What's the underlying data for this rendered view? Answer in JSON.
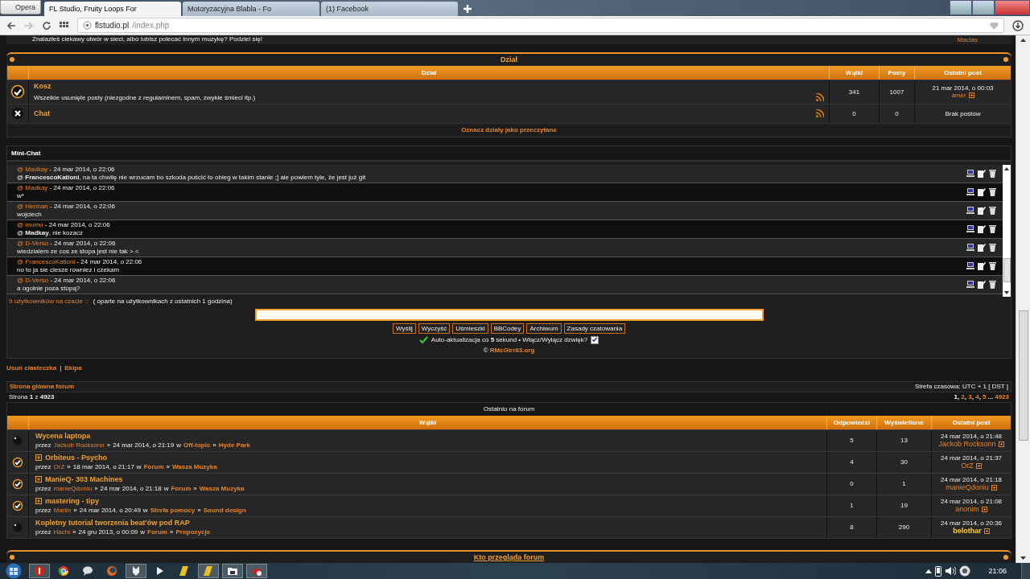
{
  "browser": {
    "menu_button": "Opera",
    "tabs": [
      {
        "title": "FL Studio, Fruity Loops For",
        "selected": true
      },
      {
        "title": "Motoryzacyjna Blabla - Fo",
        "selected": false
      },
      {
        "title": "(1) Facebook",
        "selected": false
      }
    ],
    "url": {
      "host": "flstudio.pl",
      "path": "/index.php"
    }
  },
  "intro_row": {
    "description": "Znalazłeś ciekawy utwór w sieci, albo lubisz polecać innym muzykę? Podziel się!",
    "last_author": "Macias"
  },
  "forum_section": {
    "title": "Dział",
    "columns": [
      "Dział",
      "Wątki",
      "Posty",
      "Ostatni post"
    ],
    "forums": [
      {
        "kind": "check",
        "name": "Kosz",
        "description": "Wszelkie usunięte posty (niezgodne z regulaminem, spam, zwykłe śmieci itp.)",
        "threads": "341",
        "posts": "1007",
        "last_post_date": "21 mar 2014, o 00:03",
        "last_post_author": "amer"
      },
      {
        "kind": "locked",
        "name": "Chat",
        "threads": "0",
        "posts": "0",
        "last_post_date": "Brak postów"
      }
    ],
    "mark_read": "Oznacz działy jako przeczytane"
  },
  "mini_chat": {
    "title": "Mini-Chat",
    "messages": [
      {
        "author": "@ Madkay",
        "date": "- 24 mar 2014, o 22:06",
        "text": "@ **FrancescoKationi**, na ta chwilę nie wrzucam bo szkoda puścić to obieg w takim stanie ;] ale powiem tyle, że jest już git"
      },
      {
        "author": "@ Madkay",
        "date": "- 24 mar 2014, o 22:06",
        "text": "w*"
      },
      {
        "author": "@ Herman",
        "date": "- 24 mar 2014, o 22:06",
        "text": "wojciech"
      },
      {
        "author": "@ mumu",
        "date": "- 24 mar 2014, o 22:06",
        "text": "@ **Madkay**, nie kozacz"
      },
      {
        "author": "@ D-Verso",
        "date": "- 24 mar 2014, o 22:06",
        "text": "wiedzialem ze cos ze stopa jest nie tak >.<"
      },
      {
        "author": "@ FrancescoKationi",
        "date": "- 24 mar 2014, o 22:06",
        "text": "no to ja sie ciesze rowniez i czekam"
      },
      {
        "author": "@ D-Verso",
        "date": "- 24 mar 2014, o 22:06",
        "text": "a ogolnie poza stopą?"
      }
    ],
    "users_online": "9 użytkowników na czacie ::",
    "users_note": "( oparte na użytkownikach z ostatnich 1 godzina)",
    "buttons": [
      "Wyślij",
      "Wyczyść",
      "Uśmieszki",
      "BBCodey",
      "Archiwum",
      "Zasady czatowania"
    ],
    "auto_refresh": "Auto-aktualizacja co **5** sekund • Włącz/Wyłącz dzwięk?",
    "sound_checked": true,
    "credit_symbol": "©",
    "credit_link": "RMcGirr83.org"
  },
  "footer_links": {
    "links": [
      "Usuń ciasteczka",
      "Ekipa"
    ],
    "separator": "|"
  },
  "nav": {
    "home": "Strona główna forum",
    "timezone": "Strefa czasowa: UTC + 1 [ DST ]",
    "page_info": "Strona **1** z **4923**",
    "pagination": {
      "separator": ", ",
      "pages": [
        {
          "label": "1",
          "selected": true
        },
        {
          "label": "2",
          "selected": false
        },
        {
          "label": "3",
          "selected": false
        },
        {
          "label": "4",
          "selected": false
        },
        {
          "label": "5",
          "selected": false
        }
      ],
      "ellipsis": "...",
      "last_page": "4923"
    }
  },
  "recent": {
    "title": "Ostatnio na forum",
    "columns": [
      "Wątki",
      "Odpowiedzi",
      "Wyświetlone",
      "Ostatni post"
    ],
    "topics": [
      {
        "kind": "dot",
        "expandable": false,
        "title": "Wycena laptopa",
        "by": "przez",
        "author": "Jackob Rocksonn",
        "sep1": "»",
        "date": "24 mar 2014, o 21:19",
        "in": "w",
        "forum": "Off-topic",
        "sep2": "»",
        "subforum": "Hyde Park",
        "replies": "5",
        "views": "13",
        "last_date": "24 mar 2014, o 21:48",
        "last_author": "Jackob Rocksonn",
        "last_author_highlighted": false
      },
      {
        "kind": "check",
        "expandable": true,
        "title": "Orbiteus - Psycho",
        "by": "przez",
        "author": "OrZ",
        "sep1": "»",
        "date": "18 mar 2014, o 21:17",
        "in": "w",
        "forum": "Forum",
        "sep2": "»",
        "subforum": "Wasza Muzyka",
        "replies": "4",
        "views": "30",
        "last_date": "24 mar 2014, o 21:37",
        "last_author": "OrZ",
        "last_author_highlighted": false
      },
      {
        "kind": "check",
        "expandable": true,
        "title": "ManieQ- 303 Machines",
        "by": "przez",
        "author": "manieQdoniu",
        "sep1": "»",
        "date": "24 mar 2014, o 21:18",
        "in": "w",
        "forum": "Forum",
        "sep2": "»",
        "subforum": "Wasza Muzyka",
        "replies": "0",
        "views": "1",
        "last_date": "24 mar 2014, o 21:18",
        "last_author": "manieQdoniu",
        "last_author_highlighted": false
      },
      {
        "kind": "check",
        "expandable": true,
        "title": "mastering - tipy",
        "by": "przez",
        "author": "Mariin",
        "sep1": "»",
        "date": "24 mar 2014, o 20:49",
        "in": "w",
        "forum": "Strefa pomocy",
        "sep2": "»",
        "subforum": "Sound design",
        "replies": "1",
        "views": "19",
        "last_date": "24 mar 2014, o 21:08",
        "last_author": "anonim",
        "last_author_highlighted": false
      },
      {
        "kind": "dot",
        "expandable": false,
        "title": "Kopletny tutorial tworzenia beat'ów pod RAP",
        "by": "przez",
        "author": "Hachi",
        "sep1": "»",
        "date": "24 gru 2013, o 00:09",
        "in": "w",
        "forum": "Forum",
        "sep2": "»",
        "subforum": "Propozycje",
        "replies": "8",
        "views": "290",
        "last_date": "24 mar 2014, o 20:36",
        "last_author": "belothar",
        "last_author_highlighted": true
      }
    ]
  },
  "who_online": {
    "title": "Kto przegląda forum"
  },
  "taskbar": {
    "clock": "21:06"
  }
}
